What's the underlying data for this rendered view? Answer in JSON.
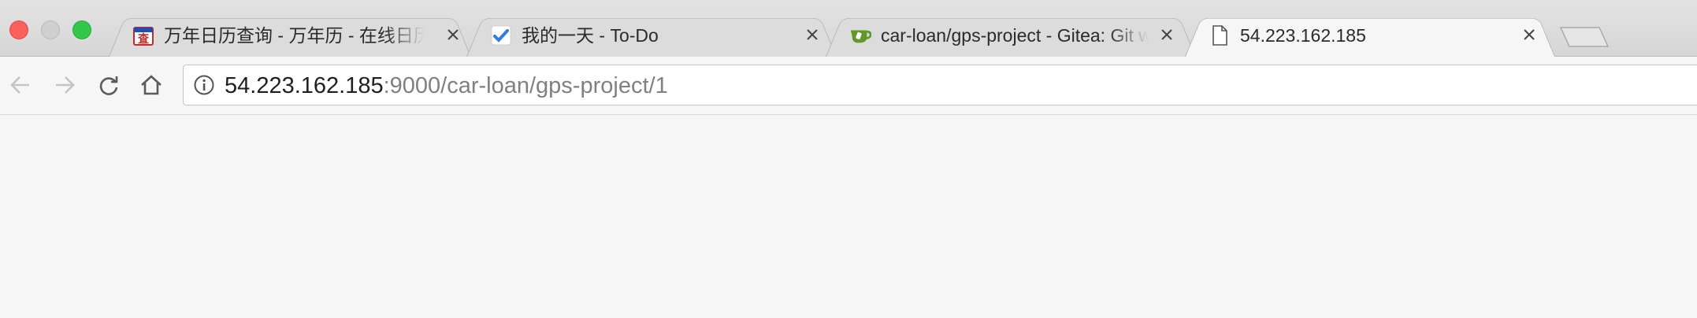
{
  "window": {
    "traffic_lights": [
      "close",
      "minimize",
      "maximize"
    ]
  },
  "tabs": [
    {
      "title": "万年日历查询 - 万年历 - 在线日历",
      "favicon": "calendar-red-icon",
      "active": false
    },
    {
      "title": "我的一天 - To-Do",
      "favicon": "todo-check-icon",
      "active": false
    },
    {
      "title": "car-loan/gps-project - Gitea: Git with a cup of tea",
      "favicon": "gitea-teacup-icon",
      "active": false
    },
    {
      "title": "54.223.162.185",
      "favicon": "blank-page-icon",
      "active": true
    }
  ],
  "toolbar": {
    "back": "back-arrow-icon",
    "forward": "forward-arrow-icon",
    "reload": "reload-icon",
    "home": "home-icon"
  },
  "omnibox": {
    "host": "54.223.162.185",
    "rest": ":9000/car-loan/gps-project/1",
    "icon": "info-icon"
  },
  "colors": {
    "tabstrip_bg": "#d9d9d9",
    "active_tab_bg": "#f6f6f6",
    "close_light": "#fc605c",
    "maximize_light": "#34c84a",
    "url_host": "#1f1f1f",
    "url_rest": "#808080"
  }
}
